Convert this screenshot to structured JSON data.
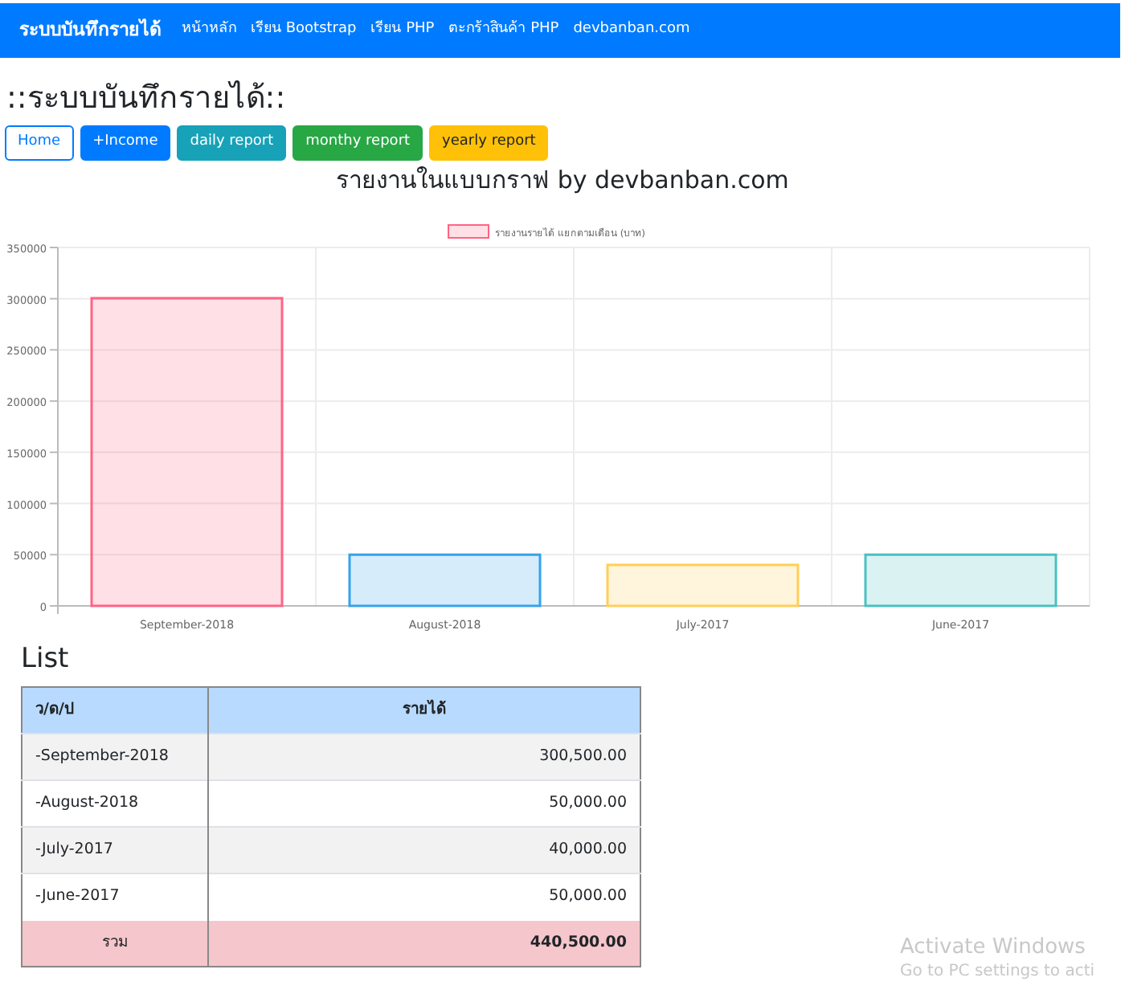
{
  "navbar": {
    "brand": "ระบบบันทึกรายได้",
    "links": [
      "หน้าหลัก",
      "เรียน Bootstrap",
      "เรียน PHP",
      "ตะกร้าสินค้า PHP",
      "devbanban.com"
    ]
  },
  "heading": "::ระบบบันทึกรายได้::",
  "buttons": [
    {
      "label": "Home",
      "kind": "outline"
    },
    {
      "label": "+Income",
      "kind": "primary"
    },
    {
      "label": "daily report",
      "kind": "info"
    },
    {
      "label": "monthy report",
      "kind": "success"
    },
    {
      "label": "yearly report",
      "kind": "warning"
    }
  ],
  "chart_title": "รายงานในแบบกราฟ by devbanban.com",
  "chart_data": {
    "type": "bar",
    "categories": [
      "September-2018",
      "August-2018",
      "July-2017",
      "June-2017"
    ],
    "series": [
      {
        "name": "รายงานรายได้ แยกตามเดือน (บาท)",
        "values": [
          300500,
          50000,
          40000,
          50000
        ]
      }
    ],
    "grid": true,
    "ylim": [
      0,
      350000
    ],
    "yticks": [
      0,
      50000,
      100000,
      150000,
      200000,
      250000,
      300000,
      350000
    ]
  },
  "list": {
    "title": "List",
    "columns": [
      "ว/ด/ป",
      "รายได้"
    ],
    "rows": [
      [
        "-September-2018",
        "300,500.00"
      ],
      [
        "-August-2018",
        "50,000.00"
      ],
      [
        "-July-2017",
        "40,000.00"
      ],
      [
        "-June-2017",
        "50,000.00"
      ]
    ],
    "total": [
      "รวม",
      "440,500.00"
    ]
  },
  "os_notice": {
    "title": "Activate Windows",
    "subtitle": "Go to PC settings to acti"
  }
}
